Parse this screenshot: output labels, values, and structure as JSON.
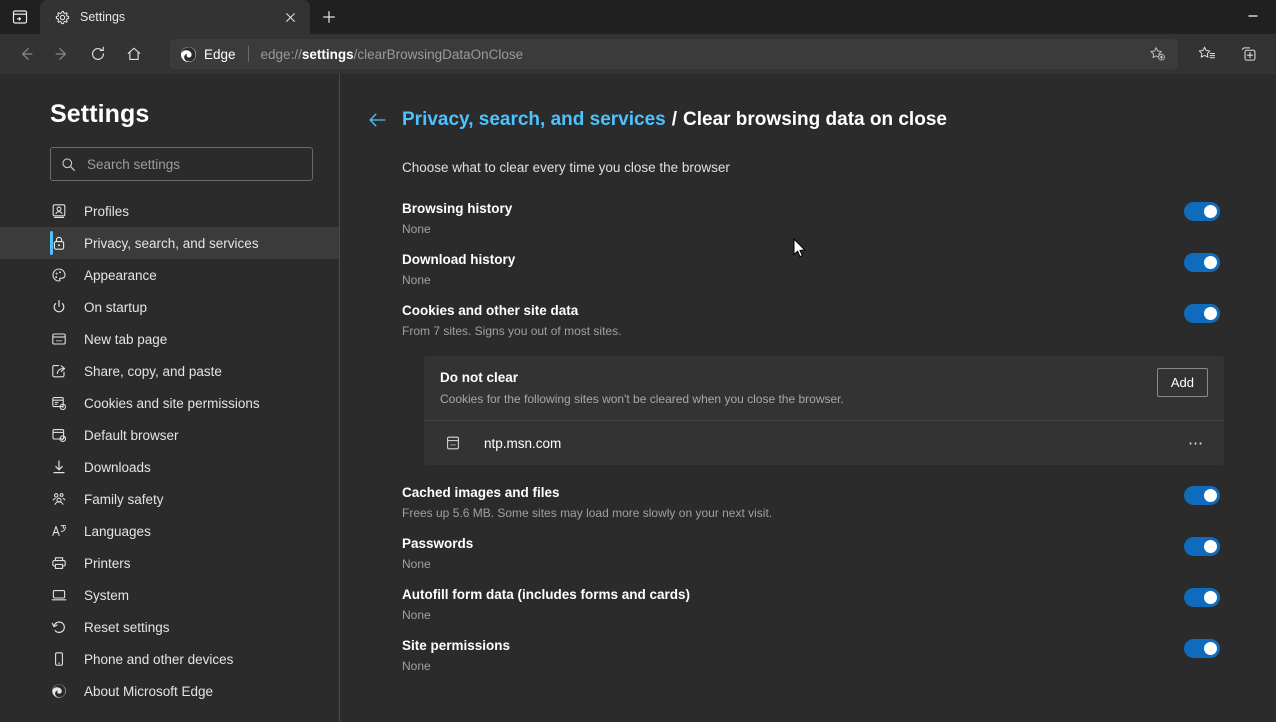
{
  "window": {
    "tab_actions_label": "Tab actions menu",
    "tab_title": "Settings",
    "tab_close_label": "Close tab",
    "new_tab_label": "New tab",
    "minimize_label": "Minimize"
  },
  "toolbar": {
    "back_label": "Back",
    "forward_label": "Forward",
    "refresh_label": "Refresh",
    "home_label": "Home",
    "brand_label": "Edge",
    "url_prefix": "edge://",
    "url_bold": "settings",
    "url_suffix": "/clearBrowsingDataOnClose",
    "url_full": "edge://settings/clearBrowsingDataOnClose",
    "add_favorite_label": "Add this page to favorites",
    "favorites_label": "Favorites",
    "collections_label": "Collections"
  },
  "sidebar": {
    "heading": "Settings",
    "search_placeholder": "Search settings",
    "search_value": "",
    "items": [
      {
        "label": "Profiles",
        "icon": "profile-icon",
        "selected": false
      },
      {
        "label": "Privacy, search, and services",
        "icon": "lock-icon",
        "selected": true
      },
      {
        "label": "Appearance",
        "icon": "palette-icon",
        "selected": false
      },
      {
        "label": "On startup",
        "icon": "power-icon",
        "selected": false
      },
      {
        "label": "New tab page",
        "icon": "new-tab-page-icon",
        "selected": false
      },
      {
        "label": "Share, copy, and paste",
        "icon": "share-icon",
        "selected": false
      },
      {
        "label": "Cookies and site permissions",
        "icon": "cookies-icon",
        "selected": false
      },
      {
        "label": "Default browser",
        "icon": "default-browser-icon",
        "selected": false
      },
      {
        "label": "Downloads",
        "icon": "download-icon",
        "selected": false
      },
      {
        "label": "Family safety",
        "icon": "family-icon",
        "selected": false
      },
      {
        "label": "Languages",
        "icon": "languages-icon",
        "selected": false
      },
      {
        "label": "Printers",
        "icon": "printer-icon",
        "selected": false
      },
      {
        "label": "System",
        "icon": "system-icon",
        "selected": false
      },
      {
        "label": "Reset settings",
        "icon": "reset-icon",
        "selected": false
      },
      {
        "label": "Phone and other devices",
        "icon": "phone-icon",
        "selected": false
      },
      {
        "label": "About Microsoft Edge",
        "icon": "edge-logo-icon",
        "selected": false
      }
    ]
  },
  "main": {
    "breadcrumb_parent": "Privacy, search, and services",
    "breadcrumb_separator": "/",
    "breadcrumb_current": "Clear browsing data on close",
    "subheading": "Choose what to clear every time you close the browser",
    "rows": [
      {
        "title": "Browsing history",
        "sub": "None",
        "enabled": true
      },
      {
        "title": "Download history",
        "sub": "None",
        "enabled": true
      },
      {
        "title": "Cookies and other site data",
        "sub": "From 7 sites. Signs you out of most sites.",
        "enabled": true
      },
      {
        "title": "Cached images and files",
        "sub": "Frees up 5.6 MB. Some sites may load more slowly on your next visit.",
        "enabled": true
      },
      {
        "title": "Passwords",
        "sub": "None",
        "enabled": true
      },
      {
        "title": "Autofill form data (includes forms and cards)",
        "sub": "None",
        "enabled": true
      },
      {
        "title": "Site permissions",
        "sub": "None",
        "enabled": true
      }
    ],
    "do_not_clear": {
      "title": "Do not clear",
      "description": "Cookies for the following sites won't be cleared when you close the browser.",
      "add_label": "Add",
      "sites": [
        {
          "name": "ntp.msn.com",
          "more_label": "⋯"
        }
      ]
    }
  },
  "colors": {
    "accent": "#4cc2ff",
    "toggle_on": "#0f6cbd",
    "titlebar_bg": "#202020",
    "toolbar_bg": "#333333",
    "page_bg": "#2b2b2b",
    "card_bg": "#333333"
  }
}
